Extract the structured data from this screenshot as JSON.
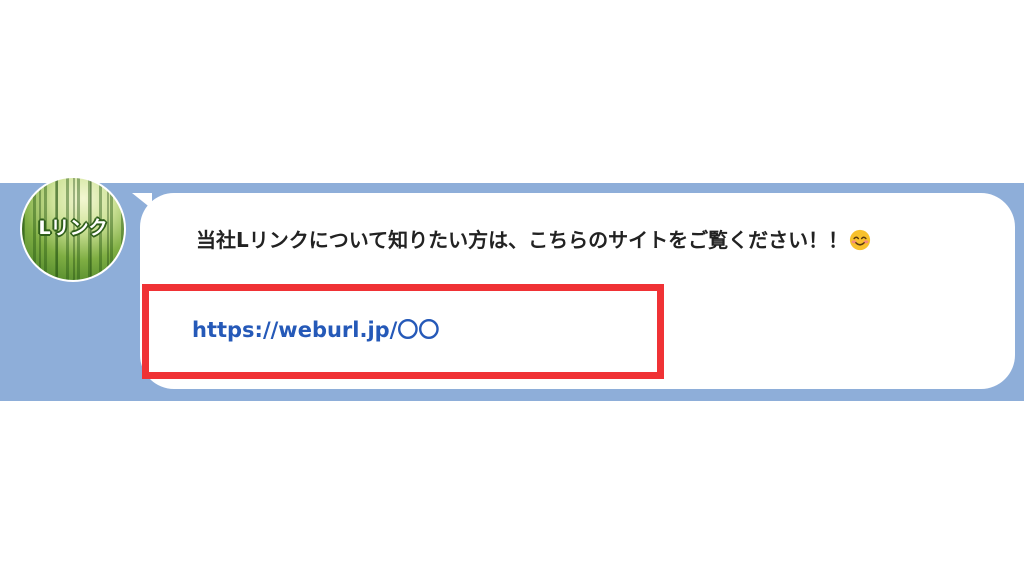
{
  "avatar": {
    "label": "Lリンク"
  },
  "message": {
    "text": "当社Lリンクについて知りたい方は、こちらのサイトをご覧ください！！",
    "emoji_icon": "smiling-face-icon",
    "link_text": "https://weburl.jp/〇〇"
  },
  "colors": {
    "band": "#8eaed9",
    "bubble": "#ffffff",
    "link": "#2559b8",
    "highlight": "#f03235"
  }
}
